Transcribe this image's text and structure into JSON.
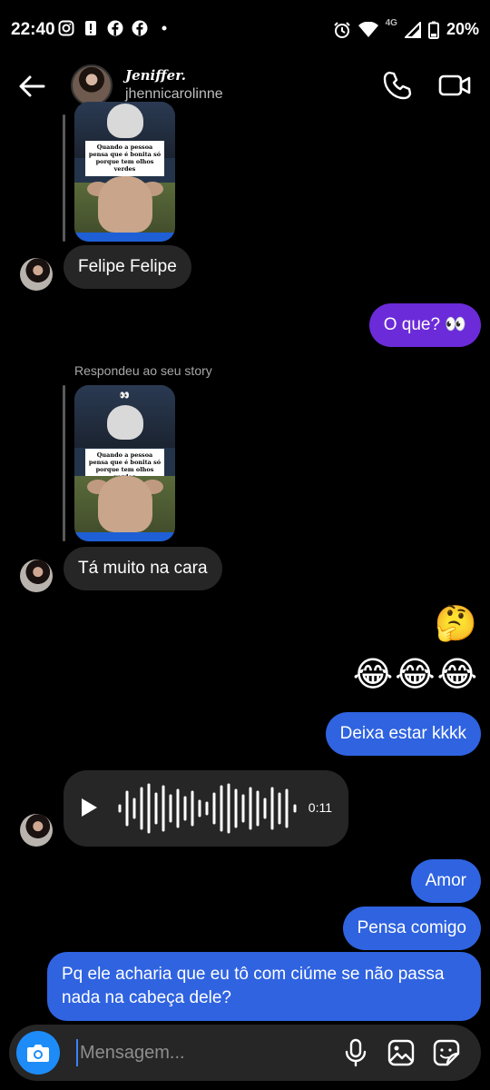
{
  "status_bar": {
    "time": "22:40",
    "network": "4G",
    "battery": "20%"
  },
  "header": {
    "display_name": "Jeniffer.",
    "username": "jhennicarolinne"
  },
  "story": {
    "caption": "Quando a pessoa pensa que é bonita só porque tem olhos verdes",
    "emoji": "👀",
    "replied_label": "Respondeu ao seu story"
  },
  "messages": {
    "m1": "Felipe Felipe",
    "m2": "O que? 👀",
    "m3": "Tá muito na cara",
    "m4": "🤔",
    "m5": "😂😂😂",
    "m6": "Deixa estar kkkk",
    "voice_duration": "0:11",
    "m7": "Amor",
    "m8": "Pensa comigo",
    "m9": "Pq ele acharia que eu tô com ciúme se não passa nada na cabeça dele?"
  },
  "composer": {
    "placeholder": "Mensagem..."
  },
  "colors": {
    "purple_bubble": "#6c2bd9",
    "blue_bubble": "#2f63e0",
    "incoming_bubble": "#262626",
    "camera_button": "#1d8cf8"
  }
}
